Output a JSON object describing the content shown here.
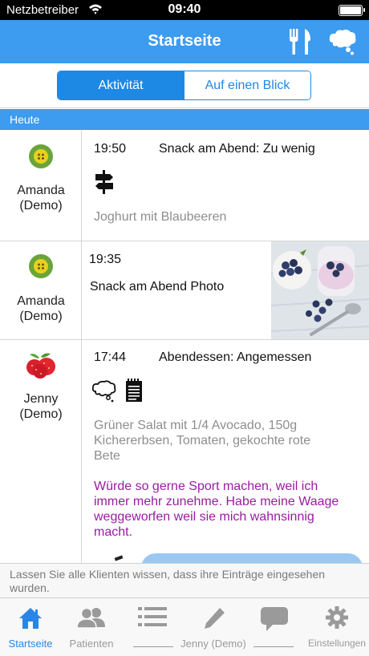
{
  "status_bar": {
    "carrier": "Netzbetreiber",
    "time": "09:40"
  },
  "nav": {
    "title": "Startseite",
    "icons": [
      "fork-knife-icon",
      "thought-bubble-icon"
    ]
  },
  "segmented": {
    "items": [
      "Aktivität",
      "Auf einen Blick"
    ],
    "selected": "Aktivität"
  },
  "section_header": "Heute",
  "entries": [
    {
      "user": "Amanda\n(Demo)",
      "time": "19:50",
      "meal": "Snack am Abend: Zu wenig",
      "icons": [
        "signpost-icon"
      ],
      "description": "Joghurt mit Blaubeeren",
      "note": ""
    },
    {
      "user": "Amanda\n(Demo)",
      "time": "19:35",
      "meal": "Snack am Abend Photo",
      "photo": "blueberry-yogurt-photo"
    },
    {
      "user": "Jenny\n(Demo)",
      "time": "17:44",
      "meal": "Abendessen: Angemessen",
      "icons": [
        "thought-bubble-icon",
        "notepad-icon"
      ],
      "description": "Grüner Salat mit 1/4 Avocado, 150g Kichererbsen, Tomaten, gekochte rote Bete",
      "note": "Würde so gerne Sport machen, weil ich immer mehr zunehme. Habe meine Waage weggeworfen weil sie mich wahnsinnig macht."
    }
  ],
  "notice": "Lassen Sie alle Klienten wissen, dass ihre Einträge eingesehen wurden.",
  "tabs": [
    {
      "label": "Startseite",
      "icon": "home-icon",
      "active": true
    },
    {
      "label": "Patienten",
      "icon": "people-icon",
      "active": false
    },
    {
      "label": "",
      "icon": "list-icon",
      "active": false
    },
    {
      "label": "",
      "icon": "pencil-icon",
      "active": false
    },
    {
      "label": "",
      "icon": "chat-icon",
      "active": false
    },
    {
      "label": "Einstellungen",
      "icon": "gear-icon",
      "active": false
    }
  ],
  "tab_group_label": "Jenny (Demo)",
  "colors": {
    "primary": "#3d9bf0",
    "segment": "#1e88e5",
    "note": "#9b1aa4",
    "muted": "#8e8e8e"
  }
}
